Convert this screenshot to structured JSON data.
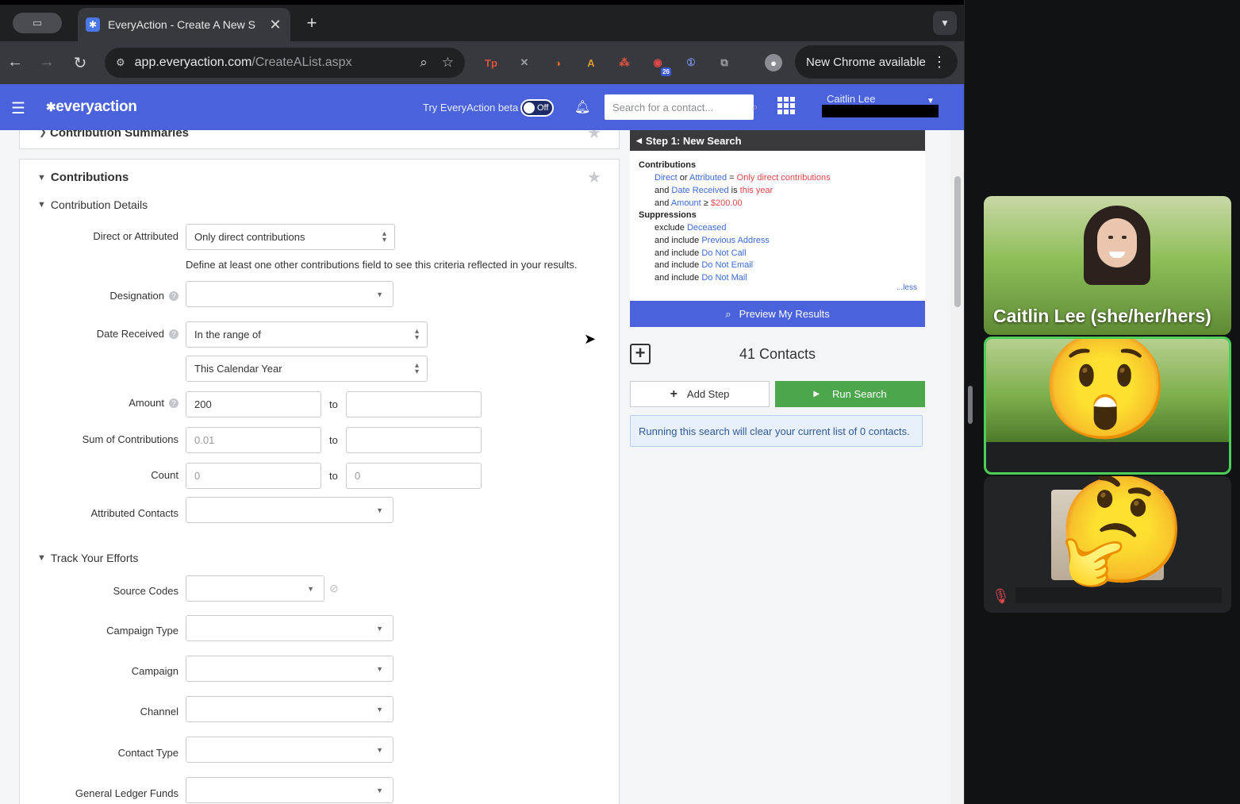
{
  "browser": {
    "tab_title": "EveryAction - Create A New S",
    "tab_close": "✕",
    "new_tab": "+",
    "url_host": "app.everyaction.com",
    "url_path": "/CreateAList.aspx",
    "update_label": "New Chrome available",
    "extensions": [
      {
        "name": "tp-extension-icon",
        "glyph": "Tp",
        "color": "#e0533a"
      },
      {
        "name": "extension-x-icon",
        "glyph": "✕",
        "color": "#9aa0a6"
      },
      {
        "name": "extension-c-icon",
        "glyph": "◑",
        "color": "#e0672c"
      },
      {
        "name": "extension-a-icon",
        "glyph": "A",
        "color": "#e09a2c"
      },
      {
        "name": "extension-dots-icon",
        "glyph": "⁂",
        "color": "#e0533a"
      },
      {
        "name": "extension-badge-icon",
        "glyph": "◉",
        "color": "#e04848",
        "badge": "26"
      },
      {
        "name": "password-manager-icon",
        "glyph": "①",
        "color": "#6f8bd9"
      },
      {
        "name": "extensions-puzzle-icon",
        "glyph": "⧉",
        "color": "#9aa0a6"
      }
    ]
  },
  "app": {
    "logo": "everyaction",
    "beta_label": "Try EveryAction beta",
    "beta_toggle": "Off",
    "search_placeholder": "Search for a contact...",
    "user_name": "Caitlin Lee"
  },
  "form": {
    "summaries_title": "Contribution Summaries",
    "contributions_title": "Contributions",
    "details_title": "Contribution Details",
    "direct_label": "Direct or Attributed",
    "direct_value": "Only direct contributions",
    "direct_hint": "Define at least one other contributions field to see this criteria reflected in your results.",
    "designation_label": "Designation",
    "date_label": "Date Received",
    "date_range": "In the range of",
    "date_period": "This Calendar Year",
    "amount_label": "Amount",
    "amount_from": "200",
    "sum_label": "Sum of Contributions",
    "sum_from": "0.01",
    "count_label": "Count",
    "count_from": "0",
    "count_to": "0",
    "to": "to",
    "attributed_label": "Attributed Contacts",
    "track_title": "Track Your Efforts",
    "source_codes_label": "Source Codes",
    "campaign_type_label": "Campaign Type",
    "campaign_label": "Campaign",
    "channel_label": "Channel",
    "contact_type_label": "Contact Type",
    "ledger_label": "General Ledger Funds"
  },
  "summary": {
    "step_title": "Step 1: New Search",
    "contributions_head": "Contributions",
    "c1": {
      "a": "Direct",
      "b": " or ",
      "c": "Attributed",
      "d": " = ",
      "e": "Only direct contributions"
    },
    "c2": {
      "a": "and ",
      "b": "Date Received",
      "c": " is ",
      "d": "this year"
    },
    "c3": {
      "a": "and ",
      "b": "Amount",
      "c": " ≥ ",
      "d": "$200.00"
    },
    "suppressions_head": "Suppressions",
    "s1": {
      "a": "exclude ",
      "b": "Deceased"
    },
    "s2": {
      "a": "and include ",
      "b": "Previous Address"
    },
    "s3": {
      "a": "and include ",
      "b": "Do Not Call"
    },
    "s4": {
      "a": "and include ",
      "b": "Do Not Email"
    },
    "s5": {
      "a": "and include ",
      "b": "Do Not Mail"
    },
    "less": "...less",
    "preview_label": "Preview My Results",
    "contacts_count": "41 Contacts",
    "add_step_label": "Add Step",
    "run_search_label": "Run Search",
    "notice": "Running this search will clear your current list of 0 contacts."
  },
  "meeting": {
    "participant1_name": "Caitlin Lee (she/her/hers)",
    "participant2_emoji": "😲",
    "participant3_emoji": "🤔"
  },
  "colors": {
    "app_blue": "#4a62dc",
    "run_green": "#4ca64c",
    "active_speaker": "#4ccf56"
  }
}
